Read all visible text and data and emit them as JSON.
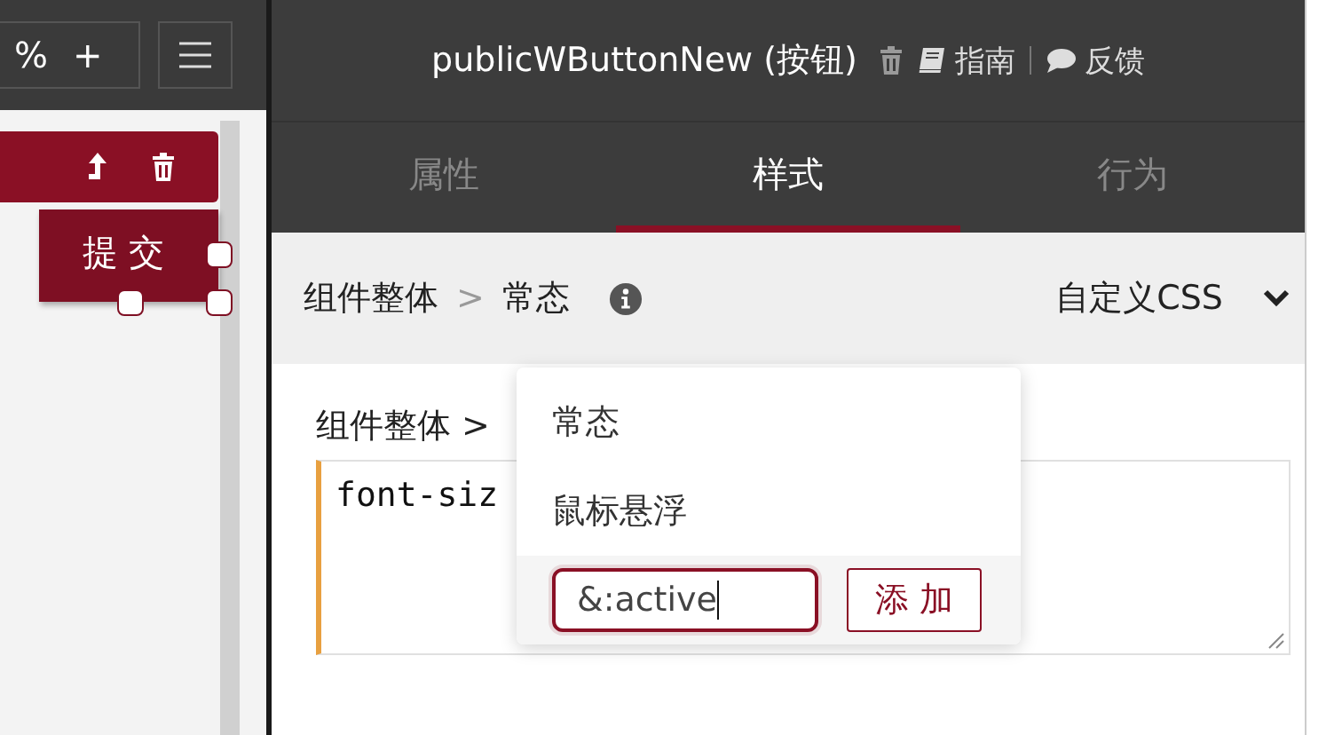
{
  "toolbar": {
    "zoom_text": "%",
    "zoom_in": "+"
  },
  "canvas": {
    "selected_button": {
      "label": "提交"
    }
  },
  "panel": {
    "title": "publicWButtonNew (按钮)",
    "links": [
      {
        "label": "指南",
        "kind": "guide"
      },
      {
        "label": "反馈",
        "kind": "feedback"
      }
    ],
    "tabs": [
      {
        "label": "属性",
        "selected": false
      },
      {
        "label": "样式",
        "selected": true
      },
      {
        "label": "行为",
        "selected": false
      }
    ],
    "breadcrumb": {
      "path": "组件整体",
      "separator": ">",
      "state": "常态",
      "mode": "自定义CSS"
    },
    "editor": {
      "label": "组件整体 >",
      "code": "font-siz"
    },
    "state_menu": {
      "items": [
        "常态",
        "鼠标悬浮"
      ],
      "input": {
        "value": "&:active"
      },
      "add_button": "添 加"
    }
  }
}
